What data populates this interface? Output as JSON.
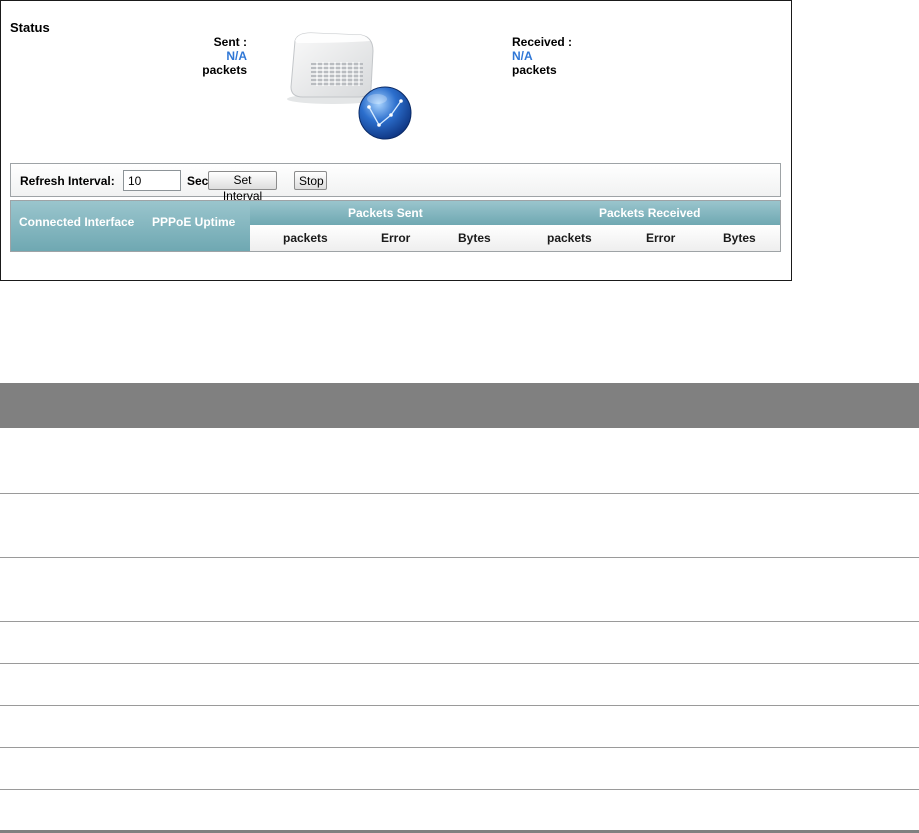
{
  "status": {
    "title": "Status",
    "sent": {
      "label": "Sent :",
      "value": "N/A",
      "unit": "packets"
    },
    "received": {
      "label": "Received :",
      "value": "N/A",
      "unit": "packets"
    }
  },
  "refresh": {
    "label": "Refresh Interval:",
    "value": "10",
    "unit": "Sec",
    "set_interval_label": "Set Interval",
    "stop_label": "Stop"
  },
  "interface_table": {
    "connected_interface": "Connected Interface",
    "pppoe_uptime": "PPPoE Uptime",
    "packets_sent": "Packets Sent",
    "packets_received": "Packets Received",
    "sub_columns": [
      "packets",
      "Error",
      "Bytes",
      "packets",
      "Error",
      "Bytes"
    ]
  },
  "colors": {
    "teal_header": "#7fb3bc",
    "value_blue": "#2f77d6",
    "desc_header_gray": "#808080"
  }
}
